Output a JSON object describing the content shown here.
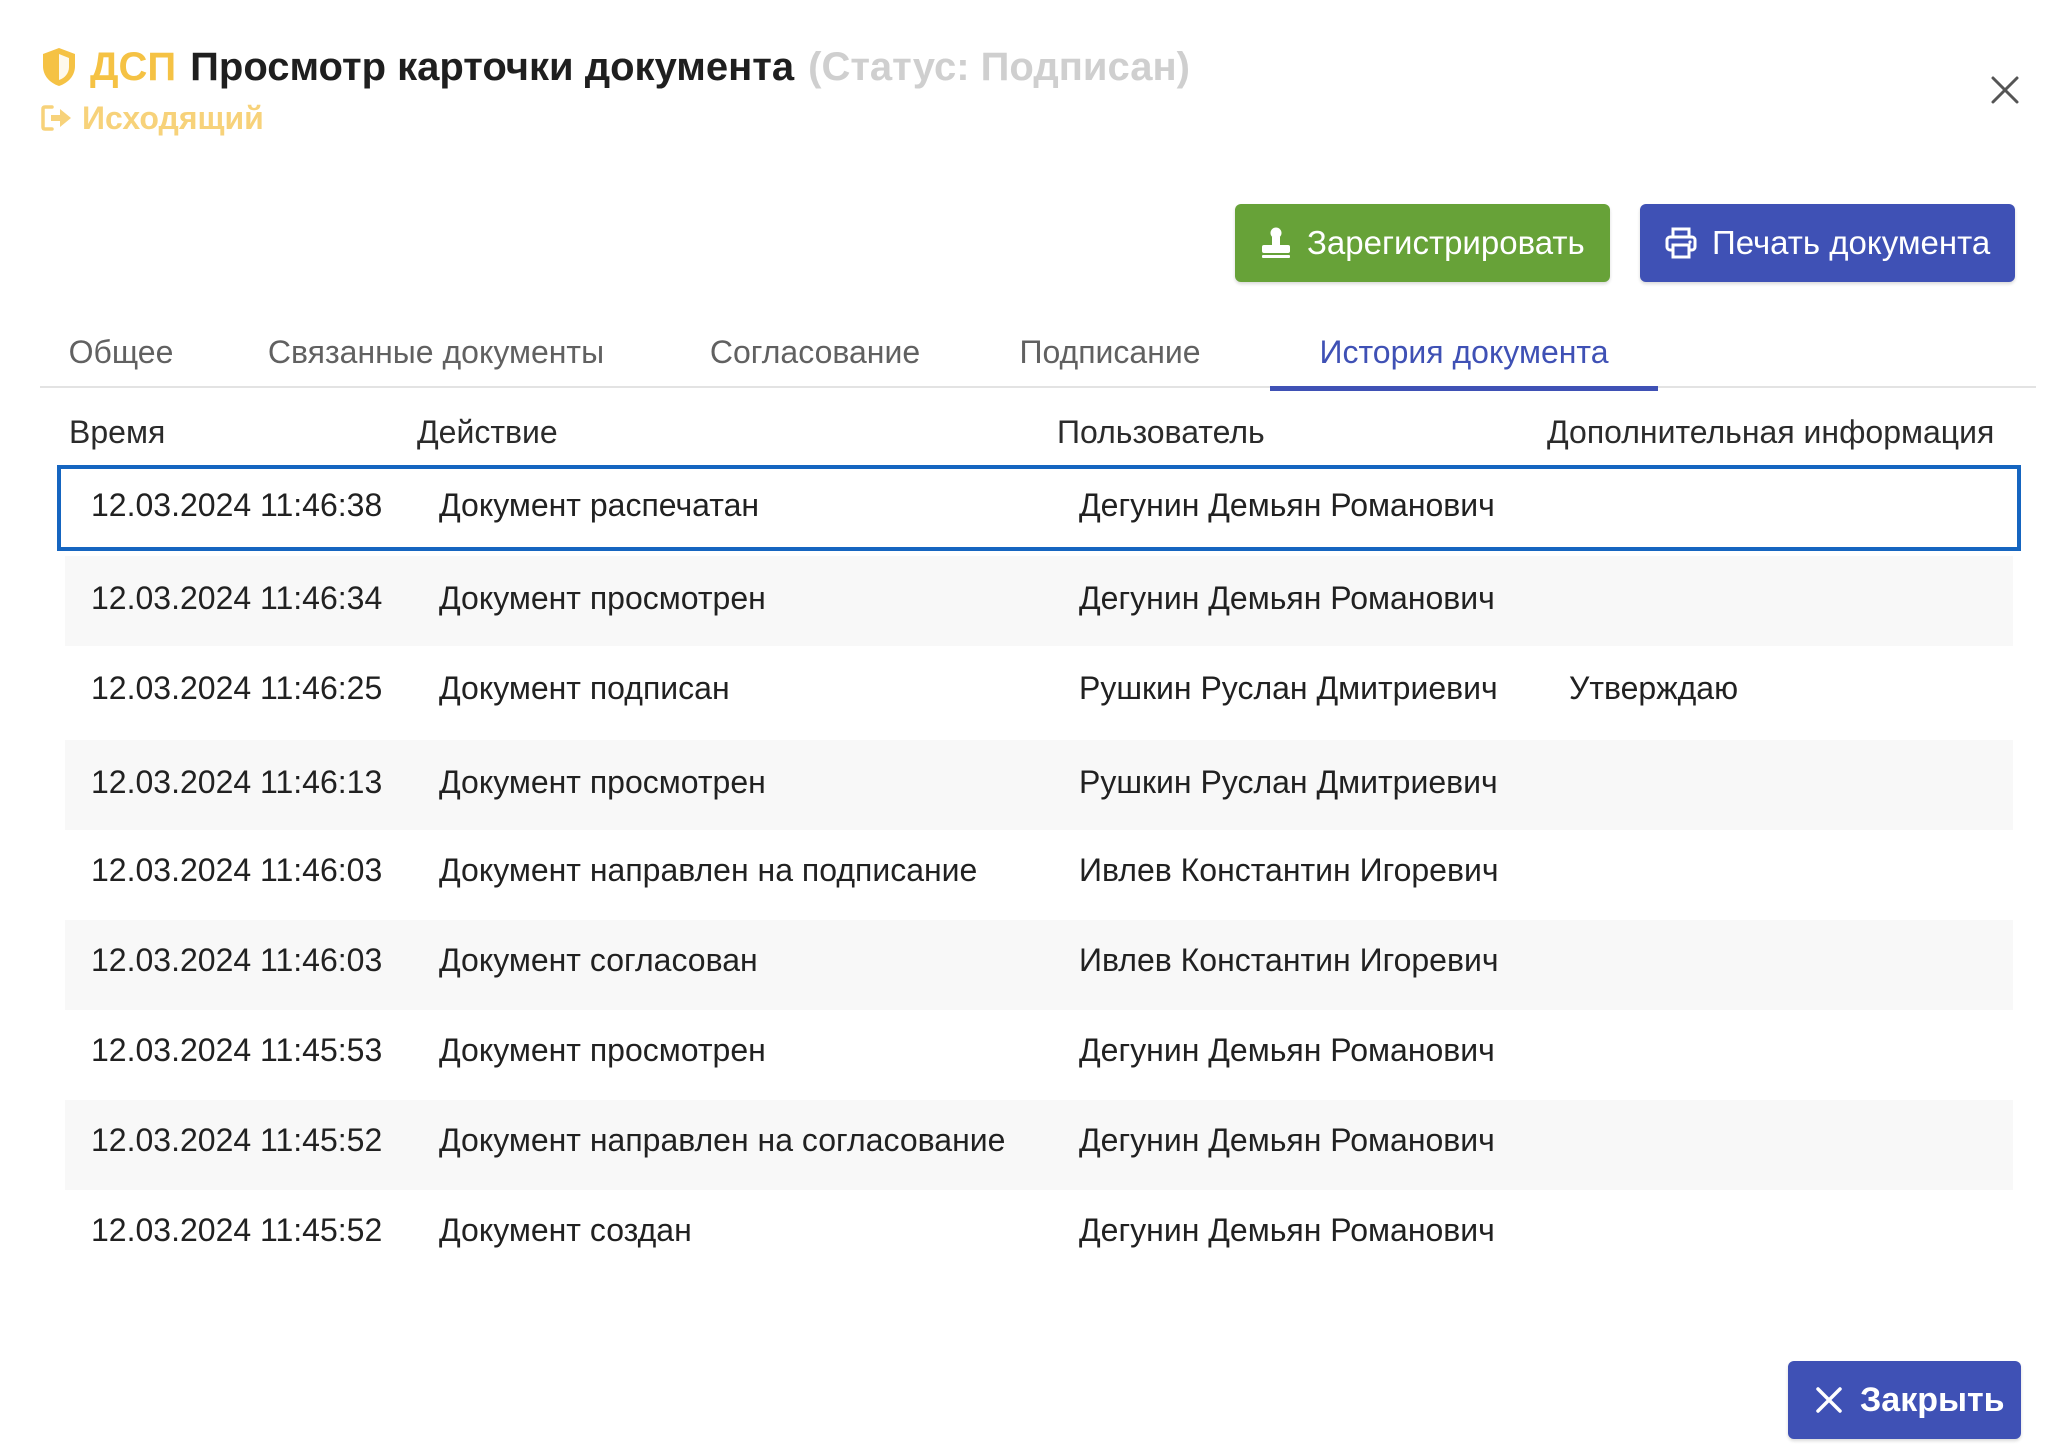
{
  "header": {
    "dsp": "ДСП",
    "title": "Просмотр карточки документа",
    "status": "(Статус: Подписан)",
    "direction": "Исходящий",
    "colors": {
      "dsp": "#f5c244",
      "direction": "#f7d27a",
      "status": "#cfcfcf"
    }
  },
  "actions": {
    "register_label": "Зарегистрировать",
    "print_label": "Печать документа",
    "close_label": "Закрыть"
  },
  "tabs": [
    {
      "label": "Общее",
      "active": false
    },
    {
      "label": "Связанные документы",
      "active": false
    },
    {
      "label": "Согласование",
      "active": false
    },
    {
      "label": "Подписание",
      "active": false
    },
    {
      "label": "История документа",
      "active": true
    }
  ],
  "history": {
    "columns": [
      "Время",
      "Действие",
      "Пользователь",
      "Дополнительная информация"
    ],
    "rows": [
      {
        "time": "12.03.2024 11:46:38",
        "action": "Документ распечатан",
        "user": "Дегунин Демьян Романович",
        "info": ""
      },
      {
        "time": "12.03.2024 11:46:34",
        "action": "Документ просмотрен",
        "user": "Дегунин Демьян Романович",
        "info": ""
      },
      {
        "time": "12.03.2024 11:46:25",
        "action": "Документ подписан",
        "user": "Рушкин Руслан Дмитриевич",
        "info": "Утверждаю"
      },
      {
        "time": "12.03.2024 11:46:13",
        "action": "Документ просмотрен",
        "user": "Рушкин Руслан Дмитриевич",
        "info": ""
      },
      {
        "time": "12.03.2024 11:46:03",
        "action": "Документ направлен на подписание",
        "user": "Ивлев Константин Игоревич",
        "info": ""
      },
      {
        "time": "12.03.2024 11:46:03",
        "action": "Документ согласован",
        "user": "Ивлев Константин Игоревич",
        "info": ""
      },
      {
        "time": "12.03.2024 11:45:53",
        "action": "Документ просмотрен",
        "user": "Дегунин Демьян Романович",
        "info": ""
      },
      {
        "time": "12.03.2024 11:45:52",
        "action": "Документ направлен на согласование",
        "user": "Дегунин Демьян Романович",
        "info": ""
      },
      {
        "time": "12.03.2024 11:45:52",
        "action": "Документ создан",
        "user": "Дегунин Демьян Романович",
        "info": ""
      }
    ]
  },
  "icons": {
    "security": "shield-icon",
    "direction": "outgoing-icon",
    "register": "stamp-icon",
    "print": "printer-icon",
    "close": "close-icon"
  }
}
